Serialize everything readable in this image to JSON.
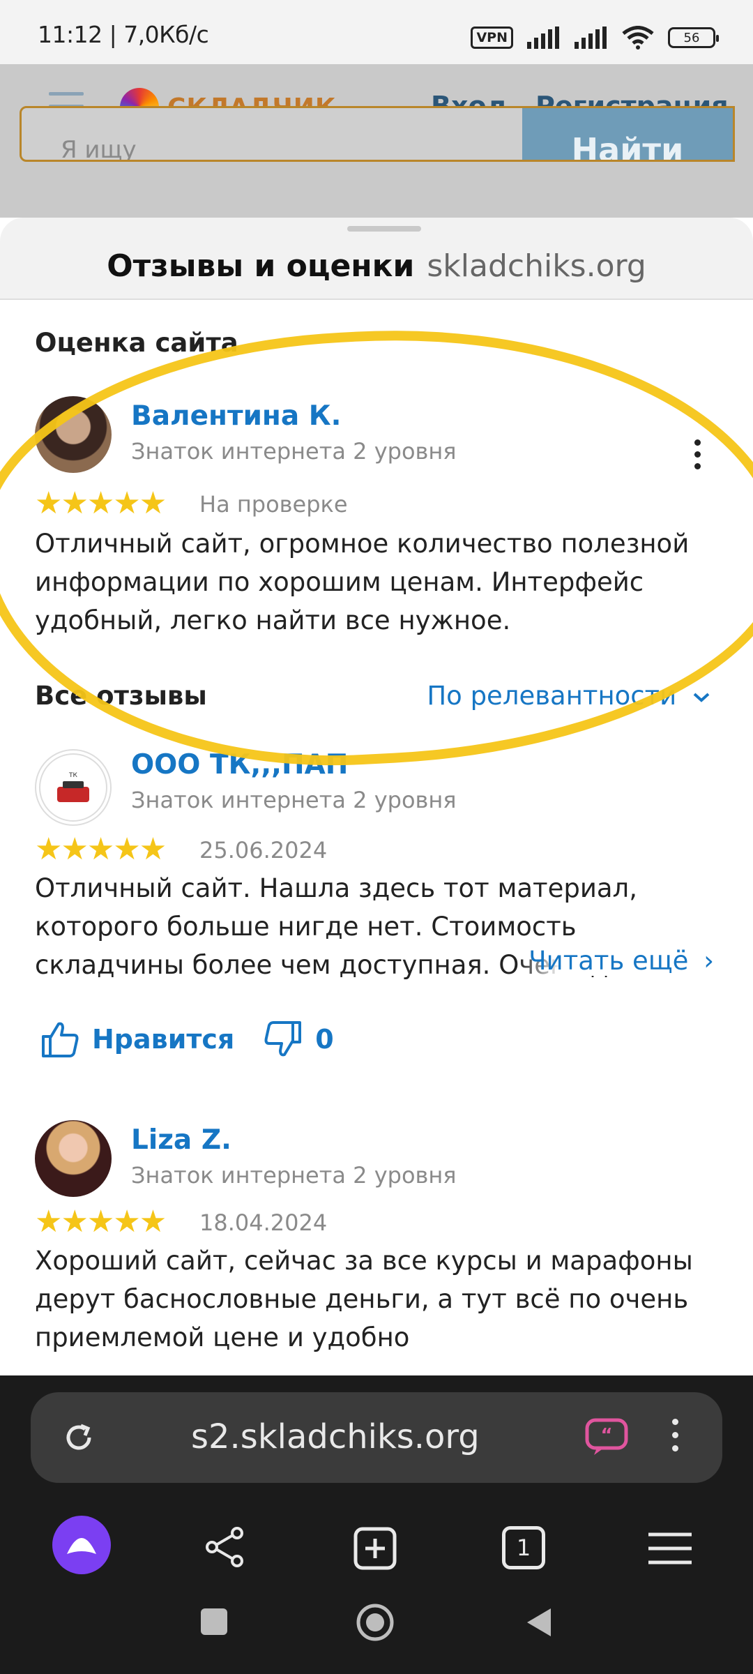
{
  "status_bar": {
    "time": "11:12 | 7,0Кб/с",
    "vpn": "VPN",
    "battery": "56"
  },
  "site": {
    "logo_text": "СКЛАДЧИК",
    "login": "Вход",
    "register": "Регистрация",
    "search_placeholder": "Я ищу",
    "search_button": "Найти"
  },
  "sheet": {
    "title": "Отзывы и оценки",
    "domain": "skladchiks.org"
  },
  "rating_section": {
    "title": "Оценка сайта"
  },
  "my_review": {
    "name": "Валентина К.",
    "level": "Знаток интернета 2 уровня",
    "stars": 5,
    "stars_text": "★★★★★",
    "status": "На проверке",
    "text": "Отличный сайт, огромное количество полезной информации по хорошим ценам. Интерфейс удобный, легко найти все нужное."
  },
  "all_reviews": {
    "title": "Все отзывы",
    "sort": "По релевантности"
  },
  "reviews": [
    {
      "name": "ООО ТК,,,ПАП",
      "level": "Знаток интернета 2 уровня",
      "stars": 5,
      "stars_text": "★★★★★",
      "date": "25.06.2024",
      "text": "Отличный сайт. Нашла здесь тот материал, которого больше нигде нет. Стоимость складчины более чем доступная. Очень довольн",
      "more": "Читать ещё",
      "like": "Нравится",
      "dislikes": "0"
    },
    {
      "name": "Liza Z.",
      "level": "Знаток интернета 2 уровня",
      "stars": 5,
      "stars_text": "★★★★★",
      "date": "18.04.2024",
      "text": "Хороший сайт, сейчас за все курсы и марафоны дерут баснословные деньги, а тут всё по очень приемлемой цене и удобно"
    }
  ],
  "browser": {
    "url": "s2.skladchiks.org",
    "tab_count": "1"
  },
  "colors": {
    "accent": "#1676c4",
    "star": "#f5c518",
    "highlight": "#f5c518",
    "alice": "#7b3ff2"
  }
}
